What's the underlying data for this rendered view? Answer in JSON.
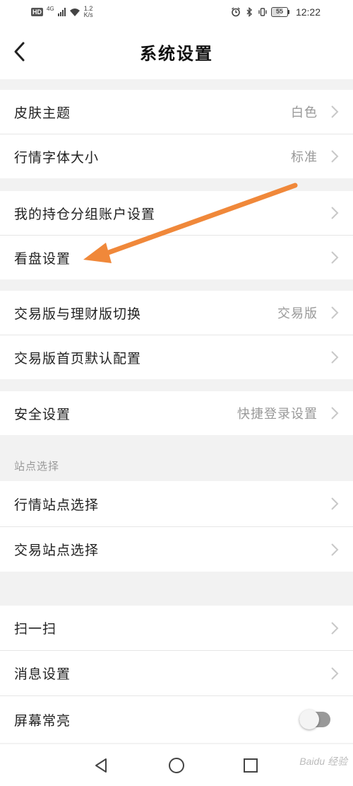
{
  "status_bar": {
    "hd": "HD",
    "network": "4G",
    "speed_value": "1.2",
    "speed_unit": "K/s",
    "battery": "55",
    "time": "12:22"
  },
  "header": {
    "back_icon": "chevron-left-icon",
    "title": "系统设置"
  },
  "settings": {
    "skin_theme": {
      "label": "皮肤主题",
      "value": "白色"
    },
    "font_size": {
      "label": "行情字体大小",
      "value": "标准"
    },
    "position_group": {
      "label": "我的持仓分组账户设置"
    },
    "view_settings": {
      "label": "看盘设置"
    },
    "edition_switch": {
      "label": "交易版与理财版切换",
      "value": "交易版"
    },
    "home_default": {
      "label": "交易版首页默认配置"
    },
    "security": {
      "label": "安全设置",
      "value": "快捷登录设置"
    },
    "site_section_title": "站点选择",
    "quote_site": {
      "label": "行情站点选择"
    },
    "trade_site": {
      "label": "交易站点选择"
    },
    "scan": {
      "label": "扫一扫"
    },
    "message_settings": {
      "label": "消息设置"
    },
    "screen_on": {
      "label": "屏幕常亮",
      "enabled": false
    }
  },
  "bottom_nav": {
    "back": "triangle-back-icon",
    "home": "circle-home-icon",
    "recents": "square-recents-icon"
  },
  "watermark": "Baidu 经验",
  "colors": {
    "accent_arrow": "#f0883a",
    "chevron": "#c8c8c8",
    "value_text": "#999999"
  }
}
